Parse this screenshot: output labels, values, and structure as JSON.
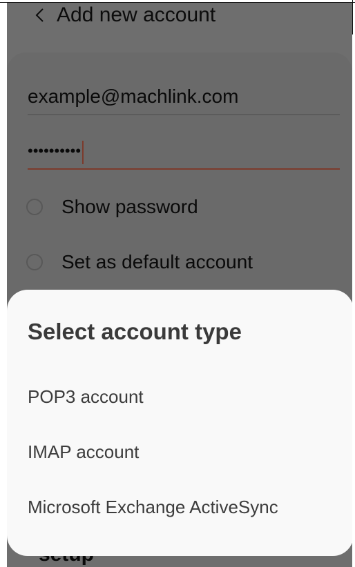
{
  "header": {
    "title": "Add new account",
    "back_icon": "chevron-left-icon"
  },
  "form": {
    "email_value": "example@machlink.com",
    "password_masked": "••••••••••",
    "show_password_label": "Show password",
    "default_account_label": "Set as default account"
  },
  "sheet": {
    "title": "Select account type",
    "options": [
      {
        "label": "POP3 account"
      },
      {
        "label": "IMAP account"
      },
      {
        "label": "Microsoft Exchange ActiveSync"
      }
    ]
  },
  "background": {
    "partial_text": "setup"
  },
  "colors": {
    "overlay": "#6e6e6e",
    "sheet": "#f9f9f9",
    "accent_underline": "#7c3b2c"
  }
}
